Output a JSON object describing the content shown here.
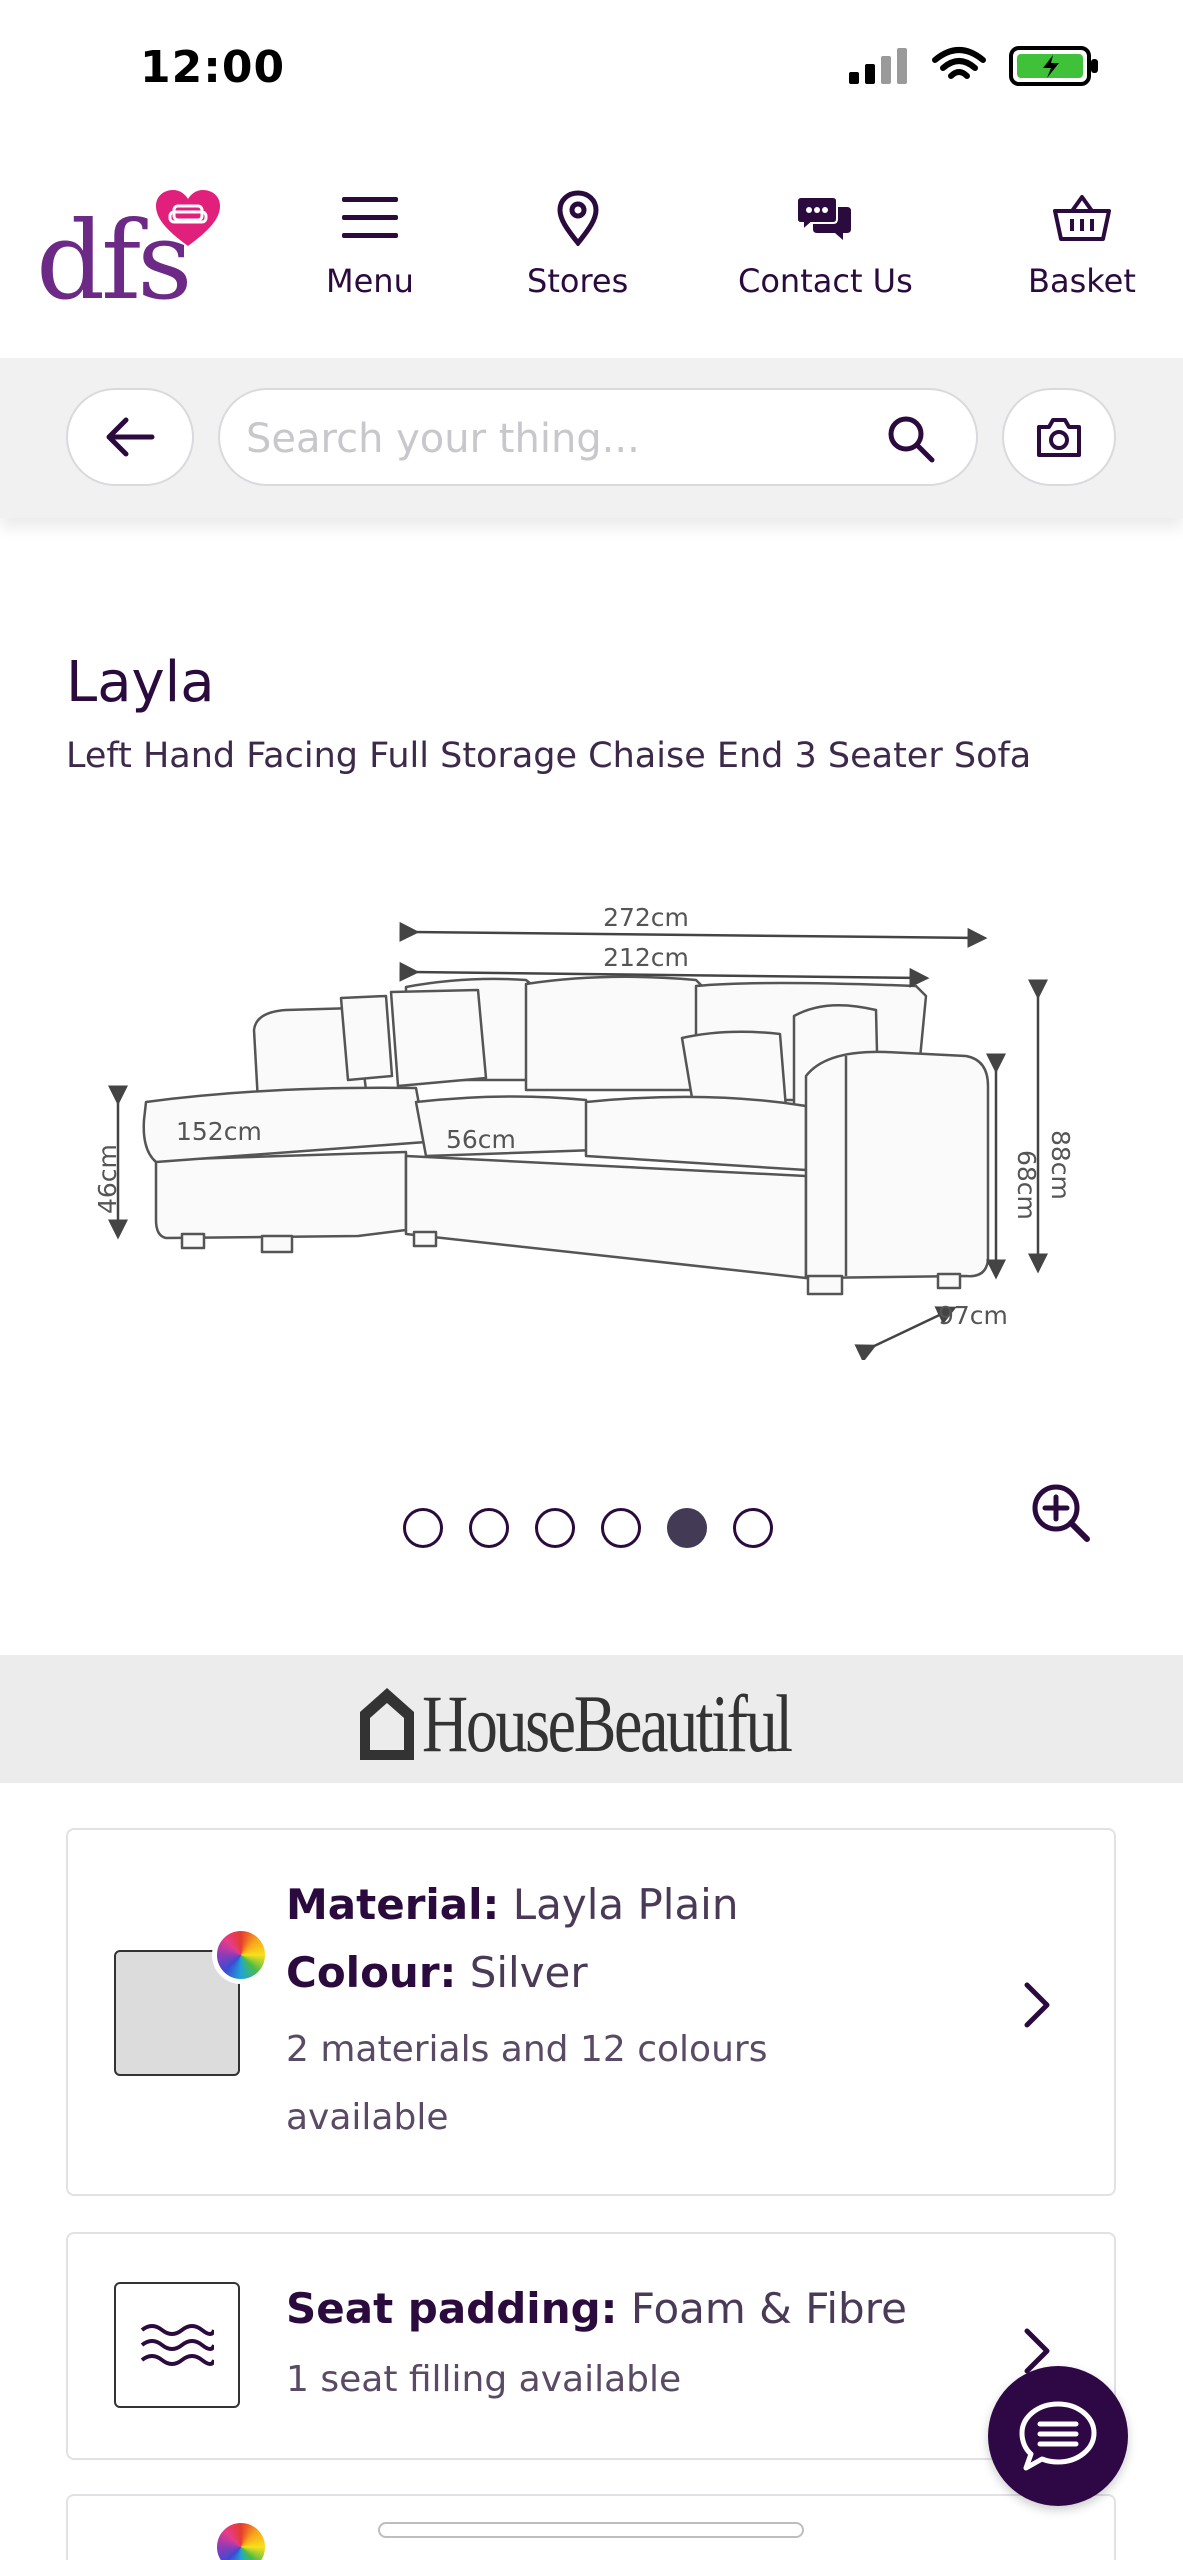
{
  "status_bar": {
    "time": "12:00"
  },
  "header": {
    "logo_text": "dfs",
    "nav": [
      {
        "label": "Menu",
        "icon": "menu-icon"
      },
      {
        "label": "Stores",
        "icon": "location-pin-icon"
      },
      {
        "label": "Contact Us",
        "icon": "chat-bubbles-icon"
      },
      {
        "label": "Basket",
        "icon": "basket-icon"
      }
    ]
  },
  "search": {
    "placeholder": "Search your thing..."
  },
  "product": {
    "name": "Layla",
    "subtitle": "Left Hand Facing Full Storage Chaise End 3 Seater Sofa"
  },
  "dimensions": {
    "total_width": "272cm",
    "sofa_width": "212cm",
    "chaise_length": "152cm",
    "seat_depth": "56cm",
    "seat_height": "46cm",
    "arm_height": "68cm",
    "total_height": "88cm",
    "depth": "97cm"
  },
  "carousel": {
    "total": 6,
    "active_index": 4
  },
  "brand_banner": {
    "text": "HouseBeautiful"
  },
  "material_card": {
    "material_label": "Material:",
    "material_value": "Layla Plain",
    "colour_label": "Colour:",
    "colour_value": "Silver",
    "availability": "2 materials and 12 colours available",
    "swatch_color": "#dcdcdc"
  },
  "padding_card": {
    "label": "Seat padding:",
    "value": "Foam & Fibre",
    "availability": "1 seat filling available"
  },
  "colors": {
    "brand_purple": "#6c2a86",
    "heart_pink": "#e0207a",
    "dark_purple": "#2b0a3d",
    "chat_fab": "#2e0845"
  }
}
